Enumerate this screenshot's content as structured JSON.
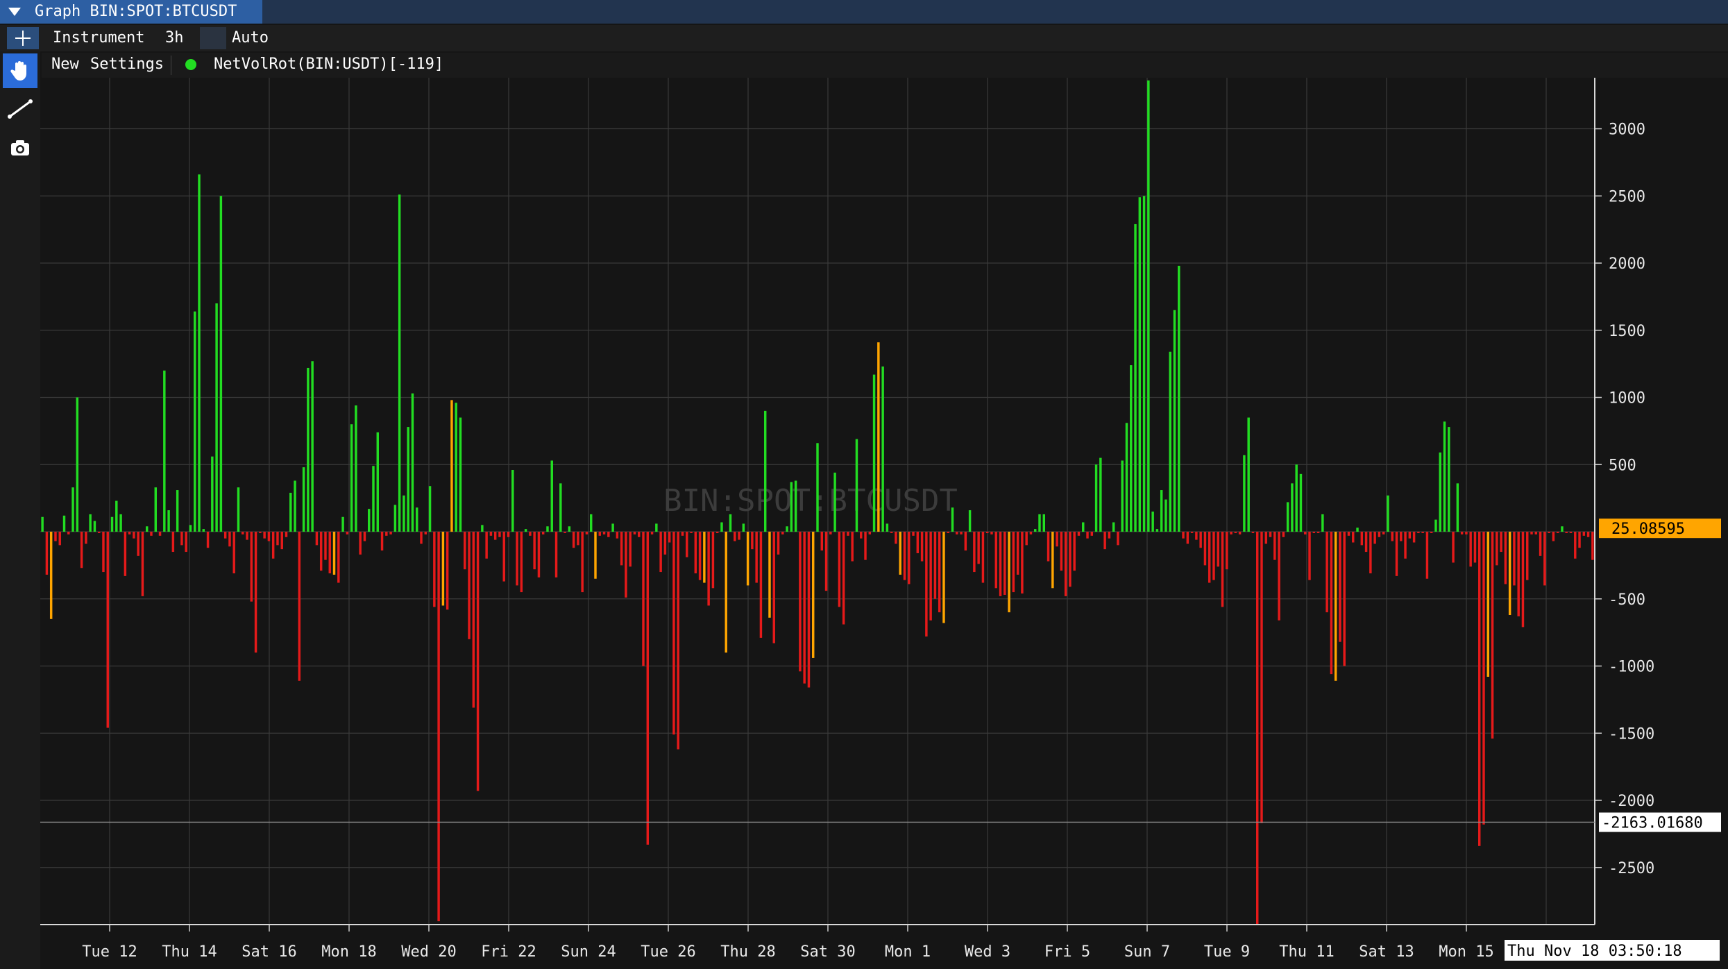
{
  "window": {
    "title": "Graph BIN:SPOT:BTCUSDT"
  },
  "toolbar": {
    "instrument_label": "Instrument",
    "interval_label": "3h",
    "scale_label": "Auto"
  },
  "indicator_bar": {
    "new_label": "New",
    "settings_label": "Settings",
    "indicator_name": "NetVolRot(BIN:USDT)[-119]",
    "indicator_color": "#22dd22"
  },
  "sidebar": {
    "tools": [
      "hand-icon",
      "line-tool-icon",
      "camera-icon"
    ]
  },
  "colors": {
    "up": "#22dd22",
    "warn": "#ffa500",
    "down": "#e51a1a",
    "last_value_bg": "#ffa500",
    "crosshair_bg": "#ffffff"
  },
  "chart_data": {
    "type": "bar",
    "watermark": "BIN:SPOT:BTCUSDT",
    "ylim": [
      -2925,
      3380
    ],
    "y_ticks": [
      -2500,
      -2000,
      -1500,
      -1000,
      -500,
      500,
      1000,
      1500,
      2000,
      2500,
      3000
    ],
    "y_tick_labels": [
      "-2500",
      "-2000",
      "-1500",
      "-1000",
      "-500",
      "500",
      "1000",
      "1500",
      "2000",
      "2500",
      "3000"
    ],
    "x_labels": [
      "Tue 12",
      "Thu 14",
      "Sat 16",
      "Mon 18",
      "Wed 20",
      "Fri 22",
      "Sun 24",
      "Tue 26",
      "Thu 28",
      "Sat 30",
      "Mon 1",
      "Wed 3",
      "Fri 5",
      "Sun 7",
      "Tue 9",
      "Thu 11",
      "Sat 13",
      "Mon 15"
    ],
    "last_value": 25.08595,
    "last_value_label": "25.08595",
    "crosshair_value_label": "-2163.01680",
    "crosshair_value": -2163.0168,
    "crosshair_time_label": "Thu Nov 18 03:50:18",
    "grid": true,
    "series_values": [
      110,
      -320,
      -650,
      -70,
      -100,
      120,
      -20,
      330,
      1000,
      -270,
      -90,
      130,
      80,
      -10,
      -300,
      -1460,
      110,
      230,
      130,
      -330,
      -20,
      -50,
      -180,
      -480,
      40,
      -30,
      330,
      -30,
      1200,
      160,
      -150,
      310,
      -100,
      -150,
      50,
      1640,
      2660,
      20,
      -120,
      560,
      1700,
      2500,
      -50,
      -110,
      -310,
      330,
      -20,
      -60,
      -520,
      -900,
      -10,
      -50,
      -70,
      -200,
      -100,
      -130,
      -40,
      290,
      380,
      -1110,
      480,
      1220,
      1270,
      -100,
      -290,
      -210,
      -310,
      -320,
      -380,
      110,
      -20,
      800,
      940,
      -170,
      -70,
      170,
      490,
      740,
      -140,
      -30,
      -20,
      200,
      2510,
      270,
      780,
      1030,
      180,
      -90,
      -20,
      340,
      -560,
      -2900,
      -550,
      -580,
      980,
      960,
      850,
      -280,
      -800,
      -1310,
      -1930,
      50,
      -200,
      -30,
      -60,
      -40,
      -370,
      -40,
      460,
      -400,
      -450,
      20,
      -30,
      -280,
      -340,
      -20,
      40,
      530,
      -340,
      360,
      -10,
      40,
      -120,
      -100,
      -450,
      -20,
      130,
      -350,
      -30,
      -20,
      -40,
      60,
      -50,
      -250,
      -490,
      -260,
      -20,
      -40,
      -1000,
      -2330,
      -20,
      60,
      -300,
      -170,
      -80,
      -1510,
      -1620,
      -30,
      -190,
      -10,
      -310,
      -360,
      -380,
      -550,
      -420,
      -10,
      70,
      -900,
      130,
      -70,
      -60,
      60,
      -400,
      -130,
      -380,
      -790,
      900,
      -640,
      -830,
      -170,
      -20,
      40,
      370,
      380,
      -1040,
      -1130,
      -1160,
      -940,
      660,
      -140,
      -440,
      -20,
      440,
      -560,
      -690,
      -30,
      -220,
      690,
      -50,
      -210,
      -20,
      1170,
      1410,
      1230,
      60,
      -10,
      -90,
      -320,
      -360,
      -390,
      -30,
      -160,
      -220,
      -780,
      -660,
      -500,
      -600,
      -680,
      -10,
      180,
      -20,
      -20,
      -140,
      160,
      -300,
      -240,
      -380,
      -10,
      -20,
      -420,
      -480,
      -470,
      -600,
      -450,
      -320,
      -460,
      -100,
      -20,
      20,
      130,
      130,
      -220,
      -420,
      -110,
      -290,
      -480,
      -410,
      -290,
      -30,
      70,
      -50,
      -30,
      500,
      550,
      -130,
      -50,
      70,
      -100,
      530,
      810,
      1240,
      2290,
      2490,
      2500,
      3360,
      150,
      20,
      310,
      240,
      1340,
      1650,
      1980,
      -50,
      -90,
      -10,
      -60,
      -120,
      -250,
      -380,
      -360,
      -260,
      -560,
      -280,
      -20,
      -10,
      -20,
      570,
      850,
      -10,
      -2930,
      -2170,
      -90,
      -40,
      -210,
      -660,
      -40,
      220,
      360,
      500,
      430,
      -20,
      -360,
      -10,
      -10,
      130,
      -600,
      -1060,
      -1110,
      -820,
      -1000,
      -30,
      -80,
      30,
      -100,
      -150,
      -310,
      -90,
      -40,
      -20,
      270,
      -70,
      -330,
      -70,
      -200,
      -50,
      -80,
      -10,
      -10,
      -350,
      -10,
      90,
      590,
      820,
      780,
      -230,
      360,
      -20,
      -20,
      -260,
      -230,
      -2340,
      -2180,
      -1080,
      -1540,
      -250,
      -150,
      -390,
      -620,
      -400,
      -630,
      -710,
      -360,
      -20,
      -20,
      -180,
      -400,
      -10,
      -70,
      -10,
      40,
      -10,
      -10,
      -200,
      -120,
      -30,
      -40,
      -210
    ]
  }
}
